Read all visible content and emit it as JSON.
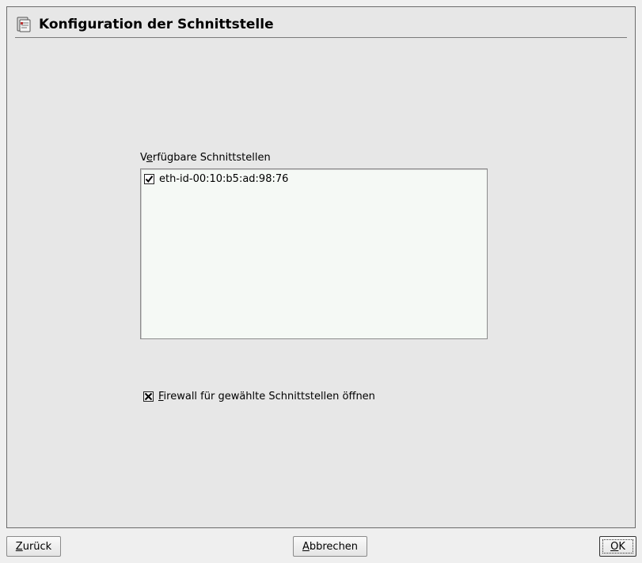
{
  "dialog": {
    "title": "Konfiguration der Schnittstelle",
    "title_icon": "network-config-icon"
  },
  "interfaces": {
    "label_prefix": "V",
    "label_mnemonic": "e",
    "label_rest": "rfügbare Schnittstellen",
    "items": [
      {
        "label": "eth-id-00:10:b5:ad:98:76",
        "checked": true
      }
    ]
  },
  "firewall": {
    "mnemonic": "F",
    "label_rest": "irewall für gewählte Schnittstellen öffnen",
    "checked": true
  },
  "buttons": {
    "back_mnemonic": "Z",
    "back_rest": "urück",
    "cancel_mnemonic": "A",
    "cancel_rest": "bbrechen",
    "ok_mnemonic": "O",
    "ok_rest": "K"
  }
}
